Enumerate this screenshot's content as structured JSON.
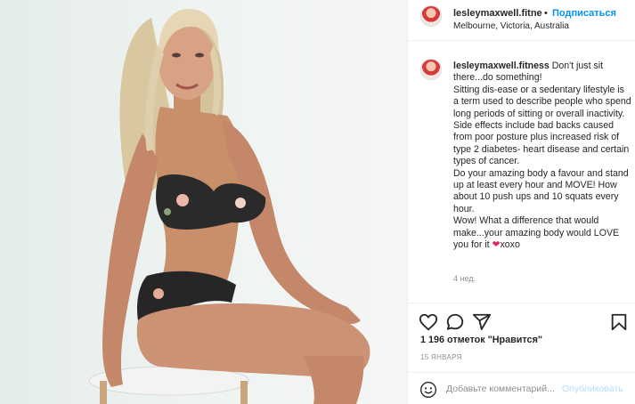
{
  "header": {
    "username": "lesleymaxwell.fitne",
    "separator": "•",
    "follow_label": "Подписаться",
    "location": "Melbourne, Victoria, Australia"
  },
  "caption": {
    "username": "lesleymaxwell.fitness",
    "lines": [
      "Don't just sit there...do something!",
      "Sitting dis-ease or a sedentary lifestyle is a term used to describe people who spend long periods of sitting or overall inactivity.",
      "Side effects include bad backs caused from poor posture plus increased risk of type 2 diabetes- heart disease and certain types of cancer.",
      "Do your amazing body a favour and stand up at least every hour and MOVE! How about 10 push ups and 10 squats every hour.",
      "Wow! What a difference that would make...your amazing body would LOVE you for it"
    ],
    "heart": "❤",
    "ending": "xoxo",
    "time_ago": "4 нед."
  },
  "actions": {
    "like_icon": "heart-outline-icon",
    "comment_icon": "comment-bubble-icon",
    "share_icon": "paper-plane-icon",
    "save_icon": "bookmark-icon"
  },
  "likes": {
    "count_text": "1 196 отметок \"Нравится\""
  },
  "date": "15 ЯНВАРЯ",
  "comment": {
    "placeholder": "Добавьте комментарий...",
    "publish_label": "Опубликовать"
  },
  "colors": {
    "link_blue": "#0095f6",
    "publish_disabled": "#b2dffc",
    "muted": "#8e8e8e",
    "heart_red": "#e0245e"
  }
}
